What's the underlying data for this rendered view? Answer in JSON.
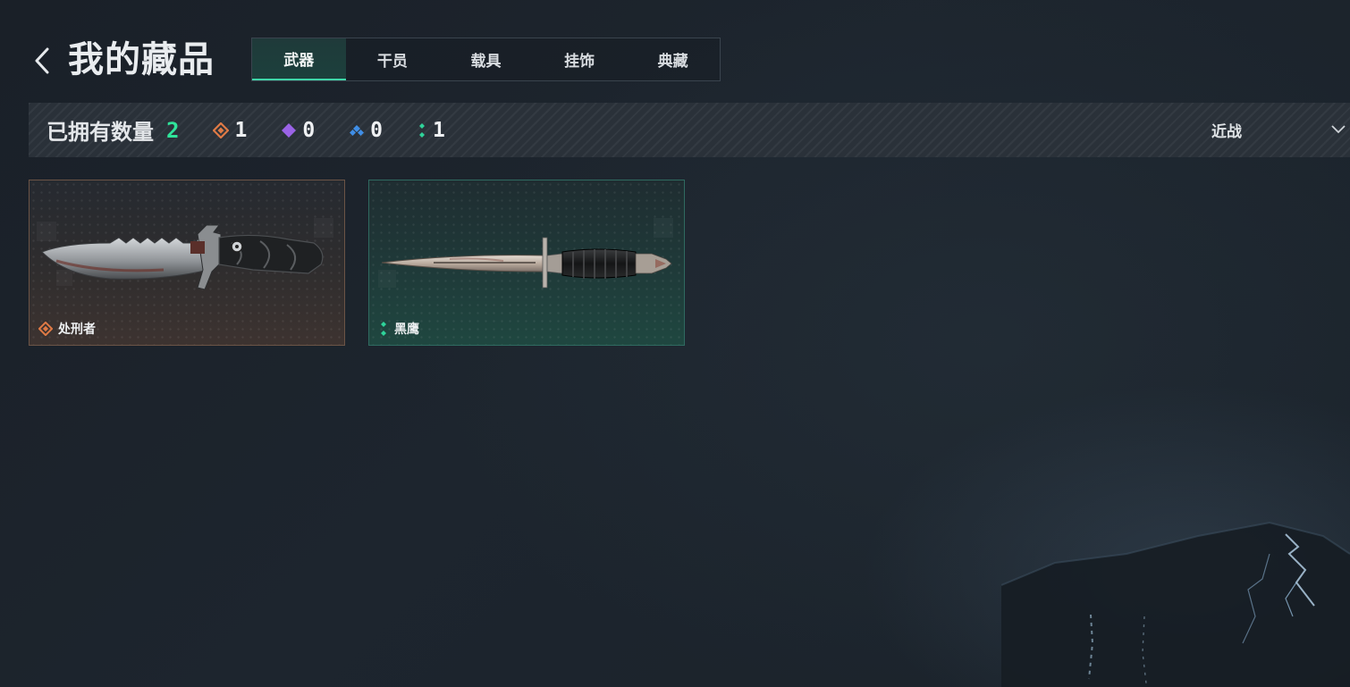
{
  "header": {
    "title": "我的藏品",
    "back_icon": "chevron-left-icon"
  },
  "tabs": [
    {
      "label": "武器",
      "active": true
    },
    {
      "label": "干员",
      "active": false
    },
    {
      "label": "载具",
      "active": false
    },
    {
      "label": "挂饰",
      "active": false
    },
    {
      "label": "典藏",
      "active": false
    }
  ],
  "stats": {
    "owned_label": "已拥有数量",
    "owned_count": "2",
    "rarities": [
      {
        "icon": "orange-diamond-icon",
        "color": "#e07a45",
        "count": "1"
      },
      {
        "icon": "purple-diamond-icon",
        "color": "#9a63e6",
        "count": "0"
      },
      {
        "icon": "blue-diamond-icon",
        "color": "#3f8ee6",
        "count": "0"
      },
      {
        "icon": "green-dots-icon",
        "color": "#2fd39a",
        "count": "1"
      }
    ]
  },
  "filter": {
    "value": "近战",
    "icon": "chevron-down-icon"
  },
  "items": [
    {
      "name": "处刑者",
      "rarity_icon": "orange-diamond-icon",
      "rarity_color": "#e07a45",
      "image": "combat-knife-icon"
    },
    {
      "name": "黑鹰",
      "rarity_icon": "green-dots-icon",
      "rarity_color": "#2fd39a",
      "image": "dagger-knife-icon"
    }
  ],
  "colors": {
    "accent": "#3fd6a8",
    "background": "#1d242c"
  }
}
